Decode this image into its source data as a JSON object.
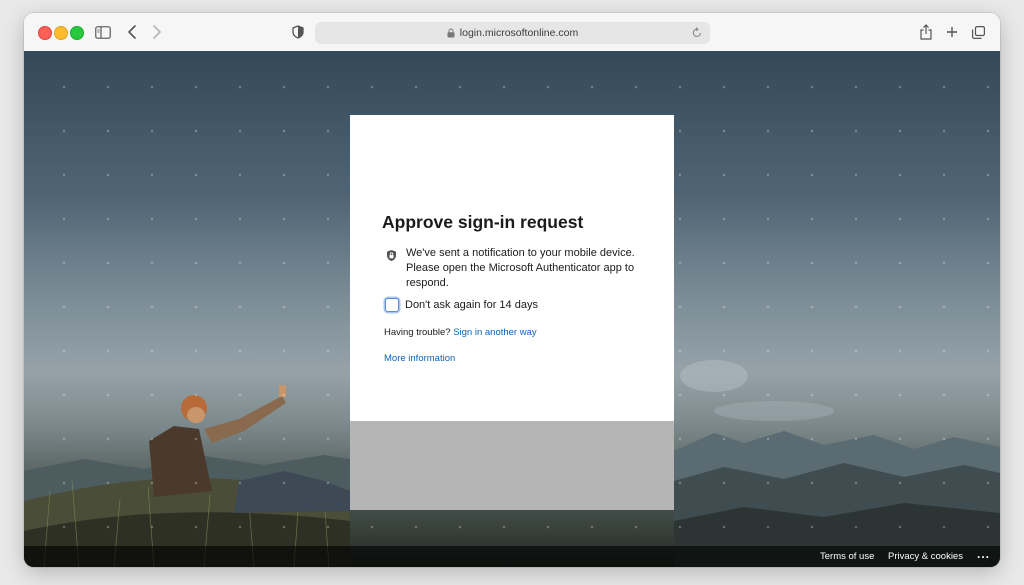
{
  "browser": {
    "url": "login.microsoftonline.com",
    "icons": [
      "sidebar-icon",
      "back-icon",
      "forward-icon",
      "shield-icon",
      "lock-icon",
      "reload-icon",
      "share-icon",
      "plus-icon",
      "tabs-icon"
    ]
  },
  "card": {
    "title": "Approve sign-in request",
    "notification_text": "We've sent a notification to your mobile device. Please open the Microsoft Authenticator app to respond.",
    "checkbox_label": "Don't ask again for 14 days",
    "checkbox_checked": false,
    "trouble_text": "Having trouble?",
    "trouble_link": "Sign in another way",
    "more_info_link": "More information"
  },
  "footer": {
    "terms": "Terms of use",
    "privacy": "Privacy & cookies",
    "more": "..."
  },
  "colors": {
    "link": "#0b63b5",
    "checkbox_border": "#5b8dd9",
    "card_bottom": "#b5b5b5"
  }
}
